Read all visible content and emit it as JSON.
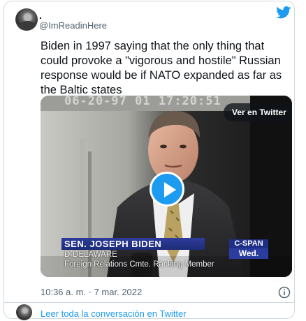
{
  "author": {
    "name": ".",
    "handle": "@ImReadinHere"
  },
  "tweet": {
    "text": "Biden in 1997 saying that the only thing that could provoke a \"vigorous and hostile\" Russian response would be if NATO expanded as far as the Baltic states",
    "timestamp": "10:36 a. m. · 7 mar. 2022"
  },
  "media": {
    "video_timestamp": "06-20-97 01 17:20:51",
    "watch_label": "Ver en Twitter",
    "lower_third": {
      "name": "SEN. JOSEPH BIDEN",
      "line2": "D-DELAWARE",
      "line3": "Foreign Relations Cmte. Ranking Member"
    },
    "network": {
      "logo": "C-SPAN",
      "day": "Wed."
    }
  },
  "footer": {
    "read_conversation": "Leer toda la conversación en Twitter"
  },
  "icons": {
    "brand": "twitter-bird-icon",
    "info": "info-icon",
    "play": "play-icon"
  },
  "colors": {
    "accent": "#1d9bf0",
    "text": "#0f1419",
    "secondary": "#536471",
    "border": "#cfd9de"
  }
}
